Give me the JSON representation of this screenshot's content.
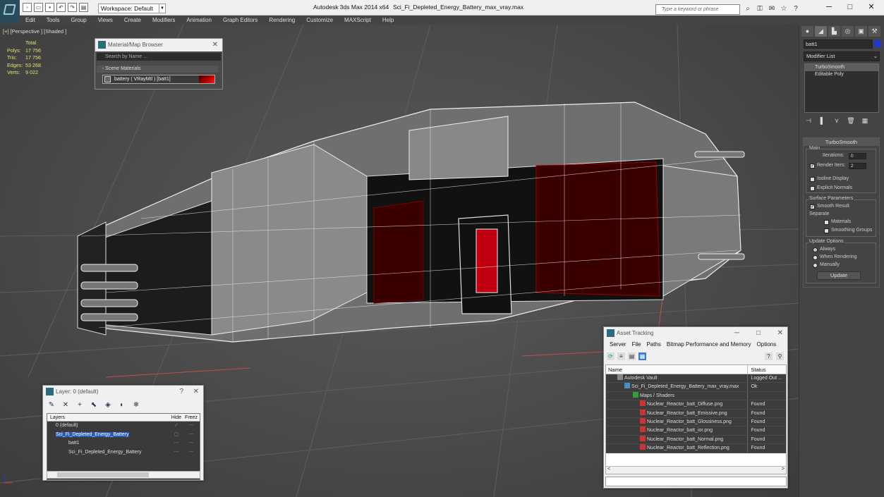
{
  "app": {
    "title": "Autodesk 3ds Max  2014 x64",
    "file": "Sci_Fi_Depleted_Energy_Battery_max_vray.max",
    "workspace": "Workspace: Default",
    "search_placeholder": "Type a keyword or phrase"
  },
  "menu": [
    "Edit",
    "Tools",
    "Group",
    "Views",
    "Create",
    "Modifiers",
    "Animation",
    "Graph Editors",
    "Rendering",
    "Customize",
    "MAXScript",
    "Help"
  ],
  "viewport": {
    "label": "[+] [Perspective ] [Shaded ]",
    "stats": {
      "header": "Total",
      "rows": [
        {
          "k": "Polys:",
          "v": "17 756"
        },
        {
          "k": "Tris:",
          "v": "17 756"
        },
        {
          "k": "Edges:",
          "v": "53 268"
        },
        {
          "k": "Verts:",
          "v": "9 022"
        }
      ]
    }
  },
  "material_browser": {
    "title": "Material/Map Browser",
    "search": "Search by Name ...",
    "section": "- Scene Materials",
    "item": "battery  ( VRayMtl )  [batt1]"
  },
  "command_panel": {
    "object_name": "batt1",
    "object_color": "#1a3ad0",
    "modifier_list": "Modifier List",
    "stack": [
      "TurboSmooth",
      "Editable Poly"
    ],
    "turbosmooth": {
      "title": "TurboSmooth",
      "main": "Main",
      "iterations_label": "Iterations:",
      "iterations": "0",
      "render_iters_label": "Render Iters:",
      "render_iters": "2",
      "isoline": "Isoline Display",
      "explicit": "Explicit Normals",
      "surface": "Surface Parameters",
      "smooth_result": "Smooth Result",
      "separate": "Separate",
      "materials": "Materials",
      "smoothing_groups": "Smoothing Groups",
      "update_options": "Update Options",
      "always": "Always",
      "when_rendering": "When Rendering",
      "manually": "Manually",
      "update": "Update"
    }
  },
  "layer_window": {
    "title": "Layer: 0 (default)",
    "col_layers": "Layers",
    "col_hide": "Hide",
    "col_freeze": "Freez",
    "rows": [
      {
        "name": "0 (default)",
        "indent": 0
      },
      {
        "name": "Sci_Fi_Depleted_Energy_Battery",
        "indent": 0,
        "selected": true
      },
      {
        "name": "batt1",
        "indent": 1
      },
      {
        "name": "Sci_Fi_Depleted_Energy_Battery",
        "indent": 1
      }
    ]
  },
  "asset_tracking": {
    "title": "Asset Tracking",
    "menu": [
      "Server",
      "File",
      "Paths",
      "Bitmap Performance and Memory",
      "Options"
    ],
    "col_name": "Name",
    "col_status": "Status",
    "rows": [
      {
        "name": "Autodesk Vault",
        "status": "Logged Out ...",
        "indent": 1
      },
      {
        "name": "Sci_Fi_Depleted_Energy_Battery_max_vray.max",
        "status": "Ok",
        "indent": 2
      },
      {
        "name": "Maps / Shaders",
        "status": "",
        "indent": 3
      },
      {
        "name": "Nuclear_Reactor_batt_Diffuse.png",
        "status": "Found",
        "indent": 4
      },
      {
        "name": "Nuclear_Reactor_batt_Emissive.png",
        "status": "Found",
        "indent": 4
      },
      {
        "name": "Nuclear_Reactor_batt_Glossiness.png",
        "status": "Found",
        "indent": 4
      },
      {
        "name": "Nuclear_Reactor_batt_ior.png",
        "status": "Found",
        "indent": 4
      },
      {
        "name": "Nuclear_Reactor_batt_Normal.png",
        "status": "Found",
        "indent": 4
      },
      {
        "name": "Nuclear_Reactor_batt_Reflection.png",
        "status": "Found",
        "indent": 4
      }
    ]
  }
}
